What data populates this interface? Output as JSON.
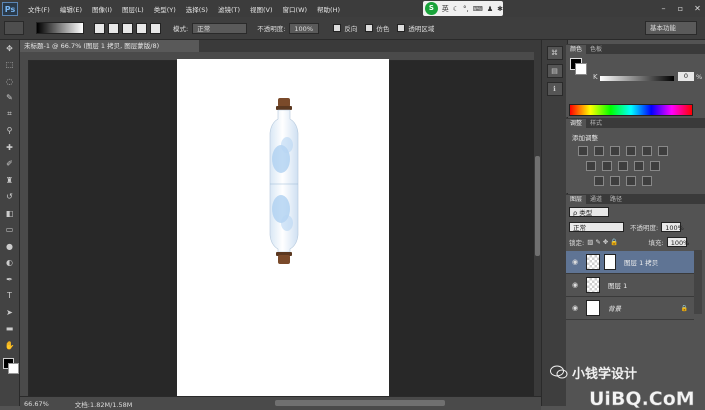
{
  "menu": {
    "app_icon": "Ps",
    "items": [
      "文件(F)",
      "编辑(E)",
      "图像(I)",
      "图层(L)",
      "类型(Y)",
      "选择(S)",
      "滤镜(T)",
      "视图(V)",
      "窗口(W)",
      "帮助(H)"
    ]
  },
  "ime": {
    "logo": "S",
    "mode": "英"
  },
  "options": {
    "mode_label": "模式:",
    "mode_value": "正常",
    "opacity_label": "不透明度:",
    "opacity_value": "100%",
    "reverse_label": "反向",
    "dither_label": "仿色",
    "transparency_label": "透明区域",
    "workspace": "基本功能"
  },
  "document": {
    "tab_title": "未标题-1 @ 66.7% (图层 1 拷贝, 图层蒙版/8)",
    "status_zoom": "66.67%",
    "status_doc": "文档:1.82M/1.58M"
  },
  "panels": {
    "color_tabs": [
      "颜色",
      "色板"
    ],
    "k_label": "K",
    "k_value": "0",
    "k_unit": "%",
    "adjust_tabs": [
      "调整",
      "样式"
    ],
    "adjust_title": "添加调整",
    "layers_tabs": [
      "图层",
      "通道",
      "路径"
    ],
    "filter_type": "ρ 类型",
    "blend_mode": "正常",
    "opacity_label": "不透明度:",
    "opacity_value": "100%",
    "lock_label": "锁定:",
    "fill_label": "填充:",
    "fill_value": "100%",
    "layers": [
      {
        "name": "图层 1 拷贝",
        "selected": true
      },
      {
        "name": "图层 1",
        "selected": false
      },
      {
        "name": "背景",
        "selected": false
      }
    ]
  },
  "watermark": {
    "text": "小钱学设计",
    "logo": "UiBQ.CoM"
  },
  "colors": {
    "selected_layer": "#5f7494",
    "canvas_bg": "#282828",
    "workspace": "#535353",
    "bottle_cap": "#7a4a2a",
    "bottle_sky": "#a9cdf0"
  }
}
